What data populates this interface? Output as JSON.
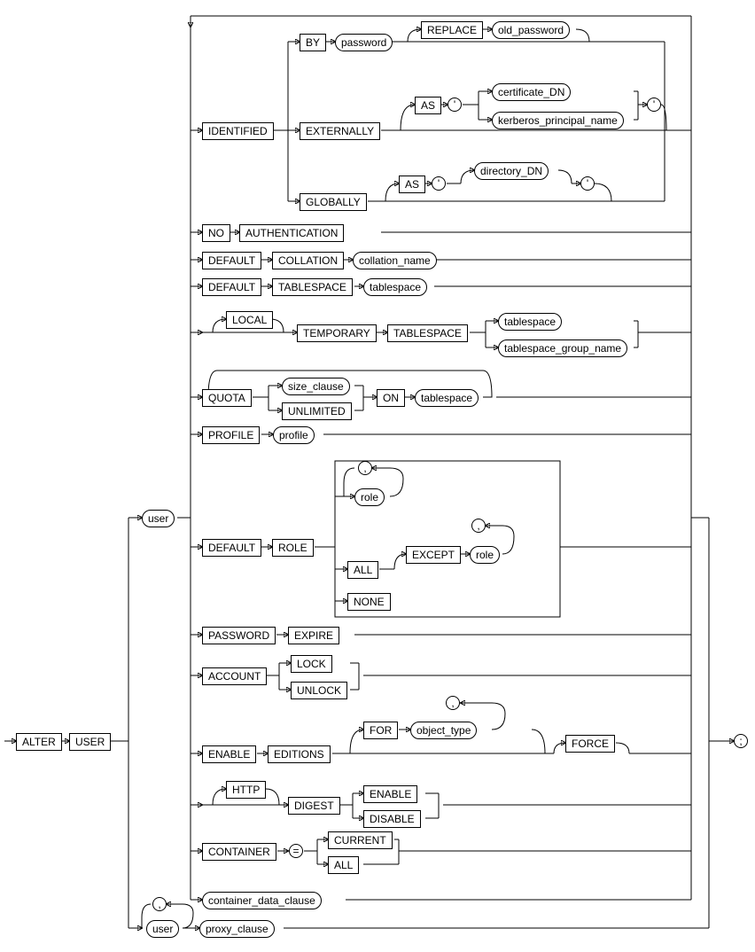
{
  "statement": "ALTER USER",
  "root": {
    "alter": "ALTER",
    "user_kw": "USER",
    "user_nt": "user",
    "semicolon": ";"
  },
  "identified": {
    "kw": "IDENTIFIED",
    "by": "BY",
    "password": "password",
    "replace": "REPLACE",
    "old_password": "old_password",
    "externally": "EXTERNALLY",
    "as1": "AS",
    "q1": "'",
    "certificate_dn": "certificate_DN",
    "kerberos": "kerberos_principal_name",
    "q2": "'",
    "globally": "GLOBALLY",
    "as2": "AS",
    "q3": "'",
    "directory_dn": "directory_DN",
    "q4": "'"
  },
  "no_auth": {
    "no": "NO",
    "auth": "AUTHENTICATION"
  },
  "def_coll": {
    "default": "DEFAULT",
    "collation": "COLLATION",
    "name": "collation_name"
  },
  "def_ts": {
    "default": "DEFAULT",
    "tablespace": "TABLESPACE",
    "ts": "tablespace"
  },
  "temp_ts": {
    "local": "LOCAL",
    "temporary": "TEMPORARY",
    "tablespace": "TABLESPACE",
    "ts": "tablespace",
    "group": "tablespace_group_name"
  },
  "quota": {
    "kw": "QUOTA",
    "size": "size_clause",
    "unlimited": "UNLIMITED",
    "on": "ON",
    "ts": "tablespace"
  },
  "profile": {
    "kw": "PROFILE",
    "name": "profile"
  },
  "def_role": {
    "default": "DEFAULT",
    "role_kw": "ROLE",
    "role": "role",
    "comma1": ",",
    "all": "ALL",
    "except": "EXCEPT",
    "role2": "role",
    "comma2": ",",
    "none": "NONE"
  },
  "pw_exp": {
    "password": "PASSWORD",
    "expire": "EXPIRE"
  },
  "account": {
    "kw": "ACCOUNT",
    "lock": "LOCK",
    "unlock": "UNLOCK"
  },
  "enable_ed": {
    "enable": "ENABLE",
    "editions": "EDITIONS",
    "for": "FOR",
    "obj": "object_type",
    "comma": ",",
    "force": "FORCE"
  },
  "digest": {
    "http": "HTTP",
    "kw": "DIGEST",
    "enable": "ENABLE",
    "disable": "DISABLE"
  },
  "container": {
    "kw": "CONTAINER",
    "eq": "=",
    "current": "CURRENT",
    "all": "ALL"
  },
  "cdc": {
    "clause": "container_data_clause"
  },
  "proxy": {
    "user": "user",
    "comma": ",",
    "clause": "proxy_clause"
  }
}
